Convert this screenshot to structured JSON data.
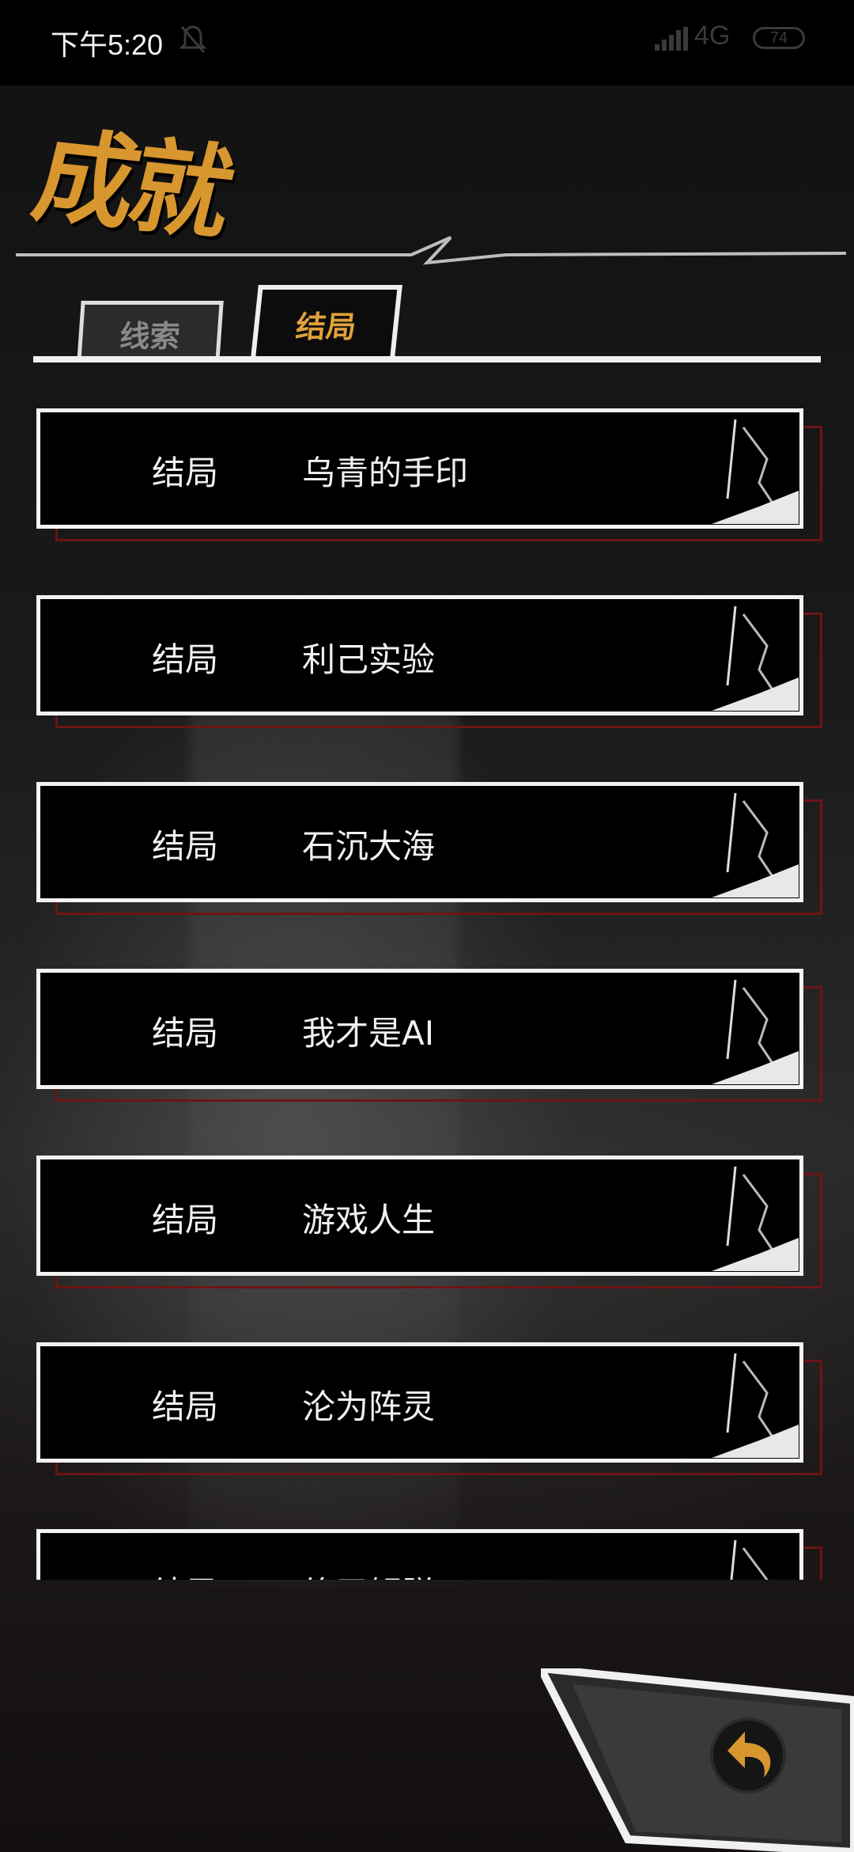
{
  "status_bar": {
    "time": "下午5:20",
    "network": "4G",
    "battery": "74"
  },
  "header": {
    "title": "成就"
  },
  "tabs": [
    {
      "label": "线索",
      "selected": false
    },
    {
      "label": "结局",
      "selected": true
    }
  ],
  "achievements": [
    {
      "type": "结局",
      "name": "乌青的手印"
    },
    {
      "type": "结局",
      "name": "利己实验"
    },
    {
      "type": "结局",
      "name": "石沉大海"
    },
    {
      "type": "结局",
      "name": "我才是AI"
    },
    {
      "type": "结局",
      "name": "游戏人生"
    },
    {
      "type": "结局",
      "name": "沦为阵灵"
    },
    {
      "type": "结局",
      "name": "终于解脱"
    }
  ],
  "colors": {
    "accent": "#d8962f",
    "card_border": "#f2f2f2",
    "card_shadow": "#6e1414"
  },
  "icons": {
    "back": "back-arrow-icon",
    "notification": "bell-off-icon"
  }
}
